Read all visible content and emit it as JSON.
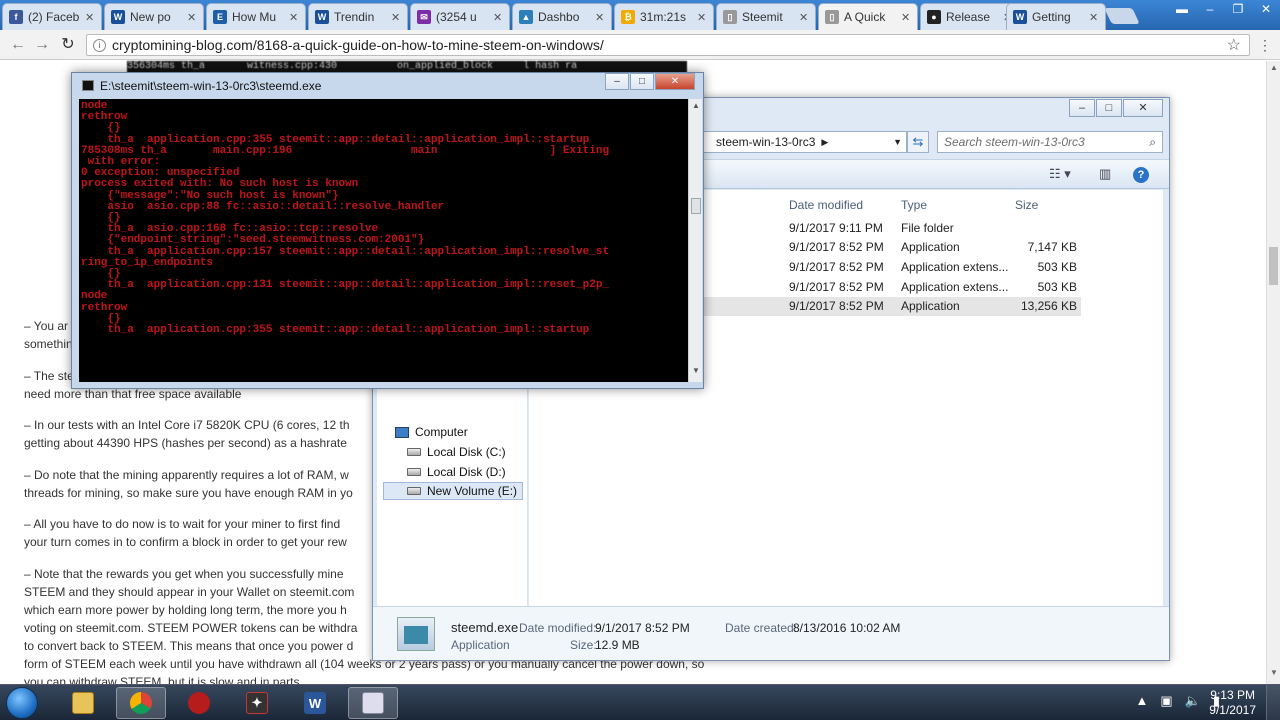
{
  "browser": {
    "tabs": [
      {
        "label": "(2) Faceb",
        "favicon": "facebook-icon",
        "color": "#3b5998",
        "glyph": "f"
      },
      {
        "label": "New po",
        "favicon": "steemit-icon",
        "color": "#1a5099",
        "glyph": "W"
      },
      {
        "label": "How Mu",
        "favicon": "e-icon",
        "color": "#1f5fa8",
        "glyph": "E"
      },
      {
        "label": "Trendin",
        "favicon": "steemit-icon",
        "color": "#1a5099",
        "glyph": "W"
      },
      {
        "label": "(3254 u",
        "favicon": "mail-icon",
        "color": "#7b2ea8",
        "glyph": "✉"
      },
      {
        "label": "Dashbo",
        "favicon": "mountain-icon",
        "color": "#2c7fb8",
        "glyph": "▲"
      },
      {
        "label": "31m:21s",
        "favicon": "bitcoin-icon",
        "color": "#f2a900",
        "glyph": "₿"
      },
      {
        "label": "Steemit",
        "favicon": "page-icon",
        "color": "#999999",
        "glyph": "▯"
      },
      {
        "label": "A Quick",
        "favicon": "page-icon",
        "color": "#999999",
        "glyph": "▯"
      },
      {
        "label": "Release",
        "favicon": "github-icon",
        "color": "#222222",
        "glyph": "●"
      },
      {
        "label": "Getting",
        "favicon": "steemit-icon",
        "color": "#1a5099",
        "glyph": "W"
      }
    ],
    "url": "cryptomining-blog.com/8168-a-quick-guide-on-how-to-mine-steem-on-windows/"
  },
  "article": {
    "paragraphs": [
      {
        "line1": "– You ar",
        "line2": "somethin"
      },
      {
        "line1": "– The ste",
        "line2": "need more than that free space available"
      },
      {
        "line1": "– In our tests with an Intel Core i7 5820K CPU (6 cores, 12 th",
        "line2": "getting about 44390 HPS (hashes per second) as a hashrate"
      },
      {
        "line1": "– Do note that the mining apparently requires a lot of RAM, w",
        "line2": "threads for mining, so make sure you have enough RAM in yo"
      },
      {
        "line1": "– All you have to do now is to wait for your miner to first find",
        "line2": "your turn comes in to confirm a block in order to get your rew"
      },
      {
        "line1": "– Note that the rewards you get when you successfully mine",
        "line2": "STEEM and they should appear in your Wallet on steemit.com",
        "line3": "which earn more power by holding long term, the more you h",
        "line4": "voting on steemit.com. STEEM POWER tokens can be withdra",
        "line5": "to convert back to STEEM. This means that once you power d",
        "line6": "form of STEEM each week until you have withdrawn all (104 weeks or 2 years pass) or you manually cancel the power down, so",
        "line7": "you can withdraw STEEM, but it is slow and in parts"
      }
    ]
  },
  "console": {
    "title": "E:\\steemit\\steem-win-13-0rc3\\steemd.exe",
    "background_strip": "356304ms th_a       witness.cpp:430          on_applied_block     l hash ra",
    "lines": [
      "node",
      "rethrow",
      "    {}",
      "    th_a  application.cpp:355 steemit::app::detail::application_impl::startup",
      "785308ms th_a       main.cpp:196                  main                 ] Exiting",
      " with error:",
      "0 exception: unspecified",
      "process exited with: No such host is known",
      "    {\"message\":\"No such host is known\"}",
      "    asio  asio.cpp:88 fc::asio::detail::resolve_handler",
      "",
      "    {}",
      "    th_a  asio.cpp:168 fc::asio::tcp::resolve",
      "",
      "    {\"endpoint_string\":\"seed.steemwitness.com:2001\"}",
      "    th_a  application.cpp:157 steemit::app::detail::application_impl::resolve_st",
      "ring_to_ip_endpoints",
      "",
      "    {}",
      "    th_a  application.cpp:131 steemit::app::detail::application_impl::reset_p2p_",
      "node",
      "rethrow",
      "    {}",
      "    th_a  application.cpp:355 steemit::app::detail::application_impl::startup"
    ]
  },
  "explorer": {
    "breadcrumb": "steem-win-13-0rc3",
    "search_placeholder": "Search steem-win-13-0rc3",
    "columns": {
      "date": "Date modified",
      "type": "Type",
      "size": "Size"
    },
    "files": [
      {
        "date": "9/1/2017 9:11 PM",
        "type": "File folder",
        "size": ""
      },
      {
        "date": "9/1/2017 8:52 PM",
        "type": "Application",
        "size": "7,147 KB"
      },
      {
        "date": "9/1/2017 8:52 PM",
        "type": "Application extens...",
        "size": "503 KB"
      },
      {
        "date": "9/1/2017 8:52 PM",
        "type": "Application extens...",
        "size": "503 KB"
      },
      {
        "date": "9/1/2017 8:52 PM",
        "type": "Application",
        "size": "13,256 KB"
      }
    ],
    "nav": {
      "computer": "Computer",
      "drives": [
        "Local Disk (C:)",
        "Local Disk (D:)",
        "New Volume (E:)"
      ]
    },
    "details": {
      "name": "steemd.exe",
      "kind": "Application",
      "modified_label": "Date modified:",
      "modified": "9/1/2017 8:52 PM",
      "size_label": "Size:",
      "size": "12.9 MB",
      "created_label": "Date created:",
      "created": "8/13/2016 10:02 AM"
    }
  },
  "taskbar": {
    "time": "9:13 PM",
    "date": "9/1/2017"
  }
}
